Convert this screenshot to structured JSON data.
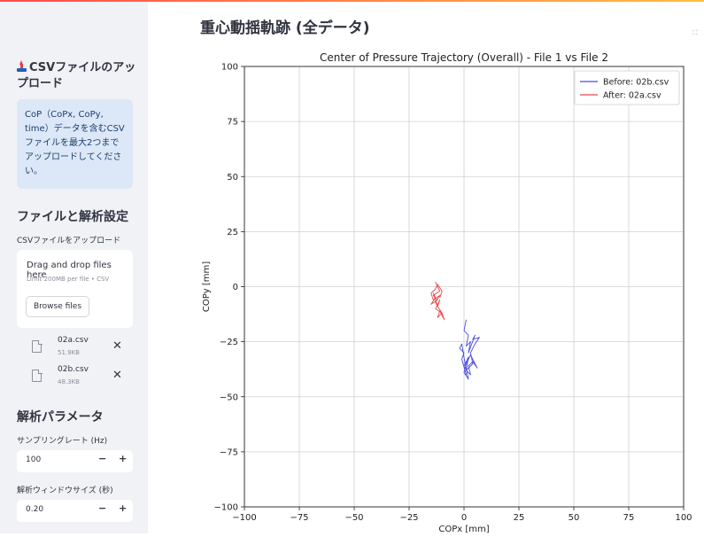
{
  "sidebar": {
    "upload_header": "CSVファイルのアップロード",
    "info_text": "CoP（CoPx, CoPy, time）データを含むCSVファイルを最大2つまでアップロードしてください。",
    "settings_title": "ファイルと解析設定",
    "upload_label": "CSVファイルをアップロード",
    "dropzone": {
      "title": "Drag and drop files here",
      "limit": "Limit 200MB per file • CSV",
      "browse_label": "Browse files"
    },
    "files": [
      {
        "name": "02a.csv",
        "size": "51.9KB"
      },
      {
        "name": "02b.csv",
        "size": "48.3KB"
      }
    ],
    "params_title": "解析パラメータ",
    "sampling_label": "サンプリングレート (Hz)",
    "sampling_value": "100",
    "window_label": "解析ウィンドウサイズ (秒)",
    "window_value": "0.20",
    "minus_label": "−",
    "plus_label": "+",
    "remove_label": "✕"
  },
  "main": {
    "title": "重心動揺軌跡 (全データ)"
  },
  "colors": {
    "before": "#4b4bdc",
    "after": "#e8474a",
    "grid": "#d0d0d0"
  },
  "chart_data": {
    "type": "line",
    "title": "Center of Pressure Trajectory (Overall) - File 1 vs File 2",
    "xlabel": "COPx [mm]",
    "ylabel": "COPy [mm]",
    "xlim": [
      -100,
      100
    ],
    "ylim": [
      -100,
      100
    ],
    "xticks": [
      -100,
      -75,
      -50,
      -25,
      0,
      25,
      50,
      75,
      100
    ],
    "yticks": [
      -100,
      -75,
      -50,
      -25,
      0,
      25,
      50,
      75,
      100
    ],
    "grid": true,
    "legend_position": "top-right",
    "series": [
      {
        "name": "Before: 02b.csv",
        "x": [
          1,
          0,
          2,
          1,
          3,
          2,
          5,
          4,
          7,
          5,
          3,
          4,
          1,
          2,
          0,
          1,
          -1,
          0,
          -2,
          -1,
          0,
          1,
          3,
          2,
          4,
          6,
          3,
          1,
          0,
          2,
          1
        ],
        "y": [
          -15,
          -20,
          -22,
          -27,
          -25,
          -30,
          -22,
          -24,
          -23,
          -26,
          -30,
          -35,
          -38,
          -32,
          -36,
          -40,
          -33,
          -30,
          -28,
          -26,
          -32,
          -38,
          -40,
          -36,
          -34,
          -37,
          -31,
          -35,
          -39,
          -42,
          -37
        ]
      },
      {
        "name": "After: 02a.csv",
        "x": [
          -12,
          -13,
          -11,
          -14,
          -12,
          -15,
          -13,
          -14,
          -12,
          -11,
          -13,
          -10,
          -12,
          -11,
          -9,
          -10,
          -12,
          -13,
          -11,
          -14,
          -15,
          -13,
          -12,
          -10,
          -11
        ],
        "y": [
          0,
          2,
          -2,
          -4,
          -6,
          -8,
          -5,
          -3,
          -9,
          -6,
          -10,
          -12,
          -14,
          -11,
          -15,
          -12,
          -9,
          -7,
          -4,
          -6,
          -3,
          -1,
          1,
          -2,
          -5
        ]
      }
    ]
  }
}
